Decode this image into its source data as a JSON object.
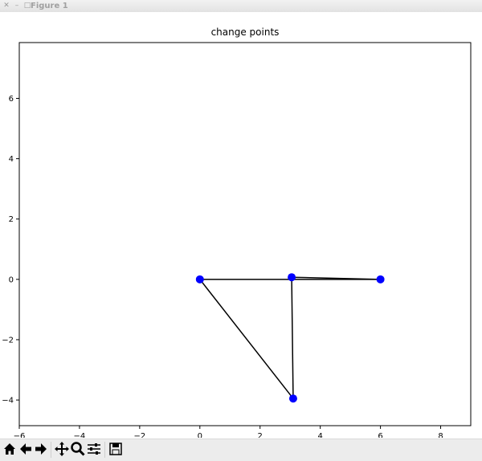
{
  "window": {
    "title": "Figure 1"
  },
  "toolbar": {
    "icons": [
      "home-icon",
      "back-arrow-icon",
      "forward-arrow-icon",
      "pan-icon",
      "zoom-icon",
      "configure-subplots-icon",
      "save-icon"
    ]
  },
  "colors": {
    "point": "#0000ff",
    "line": "#000000",
    "axes": "#000000"
  },
  "chart_data": {
    "type": "line",
    "title": "change points",
    "xlabel": "",
    "ylabel": "",
    "xlim": [
      -6,
      9
    ],
    "ylim": [
      -4.85,
      7.85
    ],
    "xticks": [
      -6,
      -4,
      -2,
      0,
      2,
      4,
      6,
      8
    ],
    "yticks": [
      -4,
      -2,
      0,
      2,
      4,
      6
    ],
    "xtick_labels": [
      "−6",
      "−4",
      "−2",
      "0",
      "2",
      "4",
      "6",
      "8"
    ],
    "ytick_labels": [
      "−4",
      "−2",
      "0",
      "2",
      "4",
      "6"
    ],
    "grid": false,
    "points": [
      {
        "x": 0,
        "y": 0
      },
      {
        "x": 3.05,
        "y": 0.07
      },
      {
        "x": 6,
        "y": 0
      },
      {
        "x": 3.1,
        "y": -3.95
      }
    ],
    "segments": [
      [
        0,
        2
      ],
      [
        1,
        2
      ],
      [
        0,
        3
      ],
      [
        1,
        3
      ]
    ]
  }
}
